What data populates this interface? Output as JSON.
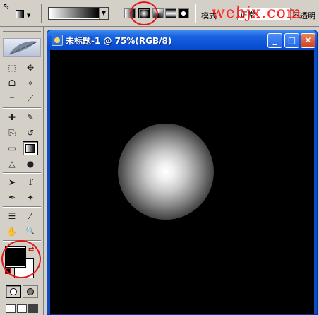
{
  "options_bar": {
    "mode_label": "模式",
    "mode_value": "正常",
    "opacity_label": "不透明"
  },
  "watermark": "webjx.com",
  "document": {
    "title": "未标题-1 @ 75%(RGB/8)",
    "minimize_label": "_",
    "maximize_label": "□",
    "close_label": "✕"
  },
  "colors": {
    "foreground": "#000000",
    "background": "#ffffff",
    "titlebar": "#0a52d8",
    "annotation": "#e31818"
  },
  "icons": {
    "move": "✥",
    "marquee": "⬚",
    "lasso": "ᗝ",
    "magic_wand": "✧",
    "crop": "⌗",
    "slice": "⟋",
    "healing": "✚",
    "brush": "✎",
    "stamp": "⎘",
    "history_brush": "↺",
    "eraser": "▭",
    "gradient": "▤",
    "blur": "△",
    "dodge": "●",
    "path_select": "➤",
    "type": "T",
    "pen": "✒",
    "shape": "✦",
    "notes": "☰",
    "eyedropper": "⁄",
    "hand": "✋",
    "zoom": "🔍",
    "swap": "⇄"
  }
}
